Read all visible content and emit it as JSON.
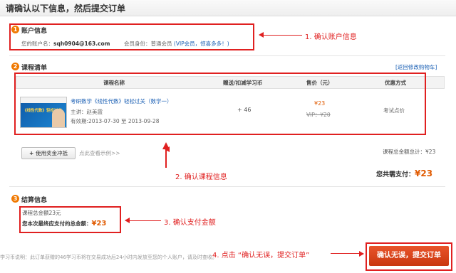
{
  "header": {
    "title": "请确认以下信息，然后提交订单"
  },
  "account": {
    "num": "1",
    "title": "账户信息",
    "name_label": "您的账户名：",
    "name_value": "sqh0904@163.com",
    "identity_label": "会员身份：",
    "identity_value": "普通会员",
    "vip_text": "(VIP会员，",
    "vip_link": "惊喜多多！",
    "vip_close": ")",
    "annotation": "1. 确认账户信息"
  },
  "courses": {
    "num": "2",
    "title": "课程清单",
    "back_link": "[返回修改购物车]",
    "columns": [
      "课程名称",
      "赠送/扣减学习币",
      "售价（元）",
      "优惠方式"
    ],
    "rows": [
      {
        "name": "考研数学《线性代数》轻松过关（数学一）",
        "teacher": "主讲：赵美霞",
        "validity": "有效期:2013-07-30 至 2013-09-28",
        "coins": "+ 46",
        "price": "¥23",
        "vip_price": "VIP：¥20",
        "discount": "考试点价",
        "thumb_text": "《线性代数》轻松过关"
      }
    ],
    "voucher_button": "使用奖金冲抵",
    "voucher_hint": "点此查看示例>>",
    "total_label": "课程总金额总计：¥23",
    "pay_label": "您共需支付：",
    "pay_value": "¥23",
    "annotation": "2. 确认课程信息"
  },
  "settlement": {
    "num": "3",
    "title": "结算信息",
    "course_total": "课程总金额23元",
    "final_label": "您本次最终应支付的总金额：",
    "final_value": "¥23",
    "annotation": "3. 确认支付金额"
  },
  "footer": {
    "note": "学习币说明：此订单获赠的46学习币将在交易成功后24小时内发放至您的个人账户，请及时查收。",
    "annotation": "4. 点击 “确认无误，提交订单”",
    "submit_button": "确认无误，提交订单"
  },
  "colors": {
    "accent": "#e05a00",
    "annotation_red": "#e02020",
    "link_blue": "#1a5fb4"
  }
}
